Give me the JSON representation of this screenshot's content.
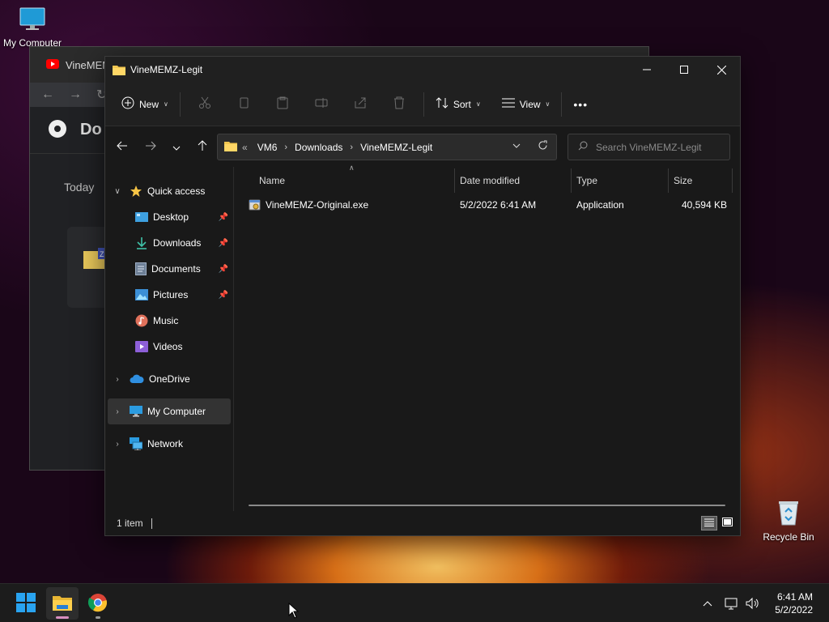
{
  "desktop": {
    "my_computer_label": "My Computer",
    "recycle_bin_label": "Recycle Bin"
  },
  "chrome_window": {
    "tab_title": "VineMEM",
    "header_title": "Do",
    "section_today": "Today"
  },
  "explorer": {
    "title": "VineMEMZ-Legit",
    "toolbar": {
      "new_label": "New",
      "sort_label": "Sort",
      "view_label": "View",
      "more_label": "•••"
    },
    "address": {
      "overflow": "«",
      "crumbs": [
        "VM6",
        "Downloads",
        "VineMEMZ-Legit"
      ]
    },
    "search_placeholder": "Search VineMEMZ-Legit",
    "nav": {
      "quick_access": "Quick access",
      "desktop": "Desktop",
      "downloads": "Downloads",
      "documents": "Documents",
      "pictures": "Pictures",
      "music": "Music",
      "videos": "Videos",
      "onedrive": "OneDrive",
      "my_computer": "My Computer",
      "network": "Network"
    },
    "columns": {
      "name": "Name",
      "date_modified": "Date modified",
      "type": "Type",
      "size": "Size"
    },
    "files": [
      {
        "name": "VineMEMZ-Original.exe",
        "date_modified": "5/2/2022 6:41 AM",
        "type": "Application",
        "size": "40,594 KB"
      }
    ],
    "status": {
      "item_count": "1 item"
    }
  },
  "taskbar": {
    "time": "6:41 AM",
    "date": "5/2/2022",
    "accent": "#0078d4",
    "explorer_indicator": "#d88ec0"
  }
}
